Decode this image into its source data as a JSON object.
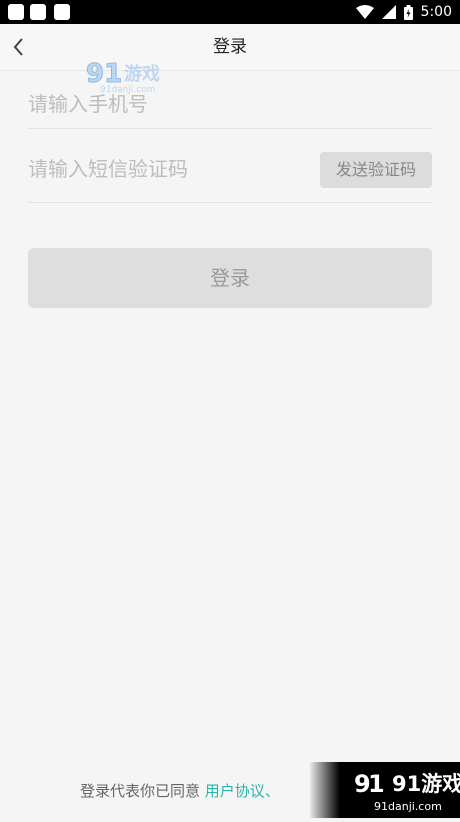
{
  "status_bar": {
    "time": "5:00"
  },
  "header": {
    "title": "登录"
  },
  "form": {
    "phone_placeholder": "请输入手机号",
    "code_placeholder": "请输入短信验证码",
    "send_code_label": "发送验证码",
    "login_label": "登录"
  },
  "agreement": {
    "prefix": "登录代表你已同意",
    "link_user_agreement": "用户协议",
    "separator": "、"
  },
  "watermark": {
    "brand": "91游戏",
    "url": "91danji.com"
  },
  "colors": {
    "link": "#2bb3a8",
    "status_bar": "#000000",
    "button_disabled": "#dedede"
  }
}
